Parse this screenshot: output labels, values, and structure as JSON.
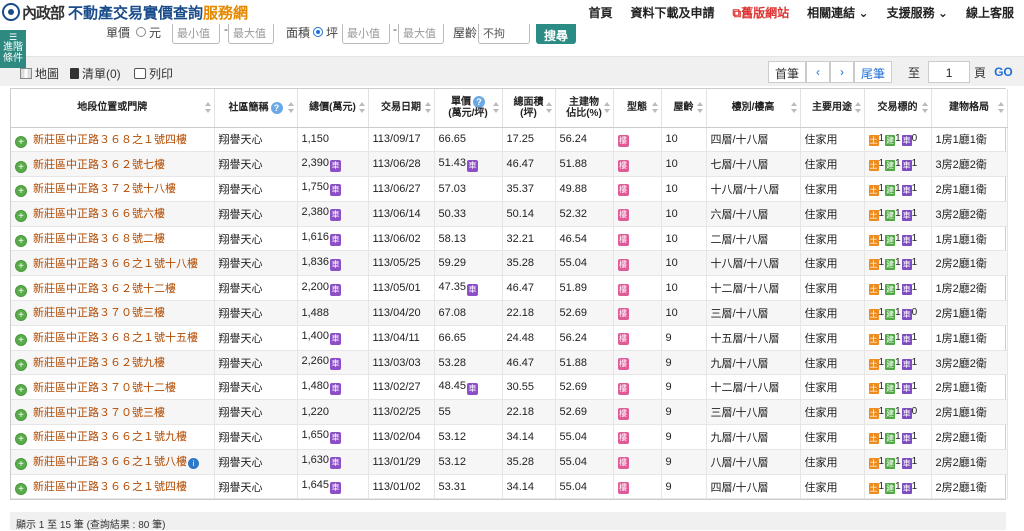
{
  "header": {
    "moi": "內政部",
    "title_main": "不動產交易實價查詢",
    "title_accent": "服務網",
    "nav": [
      "首頁",
      "資料下載及申請",
      "舊版網站",
      "相關連結",
      "支援服務",
      "線上客服"
    ]
  },
  "filter": {
    "unit_price_label": "單價",
    "unit_price_opt": "元",
    "min_placeholder": "最小值",
    "max_placeholder": "最大值",
    "area_label": "面積",
    "area_opt": "坪",
    "age_label": "屋齡",
    "age_value": "不拘",
    "search_label": "搜尋"
  },
  "advanced_filter": "進階條件",
  "toolbar": {
    "map": "地圖",
    "list": "清單(0)",
    "print": "列印",
    "first": "首筆",
    "last": "尾筆",
    "goto": "至",
    "page_value": "1",
    "page_unit": "頁",
    "go": "GO"
  },
  "columns": [
    "地段位置或門牌",
    "社區簡稱",
    "總價(萬元)",
    "交易日期",
    "單價",
    "(萬元/坪)",
    "總面積",
    "(坪)",
    "主建物",
    "佔比(%)",
    "型態",
    "屋齡",
    "樓別/樓高",
    "主要用途",
    "交易標的",
    "建物格局"
  ],
  "badges": {
    "parking": "車",
    "type": "樓",
    "land": "土",
    "building": "建",
    "car": "車"
  },
  "rows": [
    {
      "addr": "新莊區中正路３６８之１號四樓",
      "community": "翔譽天心",
      "total": "1,150",
      "park": false,
      "date": "113/09/17",
      "unit": "66.65",
      "upark": false,
      "area": "17.25",
      "main": "56.24",
      "age": "10",
      "floor": "四層/十八層",
      "use": "住家用",
      "land": "1",
      "bld": "1",
      "car": "0",
      "layout": "1房1廳1衛",
      "info": false
    },
    {
      "addr": "新莊區中正路３６２號七樓",
      "community": "翔譽天心",
      "total": "2,390",
      "park": true,
      "date": "113/06/28",
      "unit": "51.43",
      "upark": true,
      "area": "46.47",
      "main": "51.88",
      "age": "10",
      "floor": "七層/十八層",
      "use": "住家用",
      "land": "1",
      "bld": "1",
      "car": "1",
      "layout": "3房2廳2衛",
      "info": false
    },
    {
      "addr": "新莊區中正路３７２號十八樓",
      "community": "翔譽天心",
      "total": "1,750",
      "park": true,
      "date": "113/06/27",
      "unit": "57.03",
      "upark": false,
      "area": "35.37",
      "main": "49.88",
      "age": "10",
      "floor": "十八層/十八層",
      "use": "住家用",
      "land": "1",
      "bld": "1",
      "car": "1",
      "layout": "2房1廳1衛",
      "info": false
    },
    {
      "addr": "新莊區中正路３６６號六樓",
      "community": "翔譽天心",
      "total": "2,380",
      "park": true,
      "date": "113/06/14",
      "unit": "50.33",
      "upark": false,
      "area": "50.14",
      "main": "52.32",
      "age": "10",
      "floor": "六層/十八層",
      "use": "住家用",
      "land": "1",
      "bld": "1",
      "car": "1",
      "layout": "3房2廳2衛",
      "info": false
    },
    {
      "addr": "新莊區中正路３６８號二樓",
      "community": "翔譽天心",
      "total": "1,616",
      "park": true,
      "date": "113/06/02",
      "unit": "58.13",
      "upark": false,
      "area": "32.21",
      "main": "46.54",
      "age": "10",
      "floor": "二層/十八層",
      "use": "住家用",
      "land": "1",
      "bld": "1",
      "car": "1",
      "layout": "1房1廳1衛",
      "info": false
    },
    {
      "addr": "新莊區中正路３６６之１號十八樓",
      "community": "翔譽天心",
      "total": "1,836",
      "park": true,
      "date": "113/05/25",
      "unit": "59.29",
      "upark": false,
      "area": "35.28",
      "main": "55.04",
      "age": "10",
      "floor": "十八層/十八層",
      "use": "住家用",
      "land": "1",
      "bld": "1",
      "car": "1",
      "layout": "2房2廳1衛",
      "info": false
    },
    {
      "addr": "新莊區中正路３６２號十二樓",
      "community": "翔譽天心",
      "total": "2,200",
      "park": true,
      "date": "113/05/01",
      "unit": "47.35",
      "upark": true,
      "area": "46.47",
      "main": "51.89",
      "age": "10",
      "floor": "十二層/十八層",
      "use": "住家用",
      "land": "1",
      "bld": "1",
      "car": "1",
      "layout": "1房2廳2衛",
      "info": false
    },
    {
      "addr": "新莊區中正路３７０號三樓",
      "community": "翔譽天心",
      "total": "1,488",
      "park": false,
      "date": "113/04/20",
      "unit": "67.08",
      "upark": false,
      "area": "22.18",
      "main": "52.69",
      "age": "10",
      "floor": "三層/十八層",
      "use": "住家用",
      "land": "1",
      "bld": "1",
      "car": "0",
      "layout": "2房1廳1衛",
      "info": false
    },
    {
      "addr": "新莊區中正路３６８之１號十五樓",
      "community": "翔譽天心",
      "total": "1,400",
      "park": true,
      "date": "113/04/11",
      "unit": "66.65",
      "upark": false,
      "area": "24.48",
      "main": "56.24",
      "age": "9",
      "floor": "十五層/十八層",
      "use": "住家用",
      "land": "1",
      "bld": "1",
      "car": "1",
      "layout": "1房1廳1衛",
      "info": false
    },
    {
      "addr": "新莊區中正路３６２號九樓",
      "community": "翔譽天心",
      "total": "2,260",
      "park": true,
      "date": "113/03/03",
      "unit": "53.28",
      "upark": false,
      "area": "46.47",
      "main": "51.88",
      "age": "9",
      "floor": "九層/十八層",
      "use": "住家用",
      "land": "1",
      "bld": "1",
      "car": "1",
      "layout": "3房2廳2衛",
      "info": false
    },
    {
      "addr": "新莊區中正路３７０號十二樓",
      "community": "翔譽天心",
      "total": "1,480",
      "park": true,
      "date": "113/02/27",
      "unit": "48.45",
      "upark": true,
      "area": "30.55",
      "main": "52.69",
      "age": "9",
      "floor": "十二層/十八層",
      "use": "住家用",
      "land": "1",
      "bld": "1",
      "car": "1",
      "layout": "2房1廳1衛",
      "info": false
    },
    {
      "addr": "新莊區中正路３７０號三樓",
      "community": "翔譽天心",
      "total": "1,220",
      "park": false,
      "date": "113/02/25",
      "unit": "55",
      "upark": false,
      "area": "22.18",
      "main": "52.69",
      "age": "9",
      "floor": "三層/十八層",
      "use": "住家用",
      "land": "1",
      "bld": "1",
      "car": "0",
      "layout": "2房1廳1衛",
      "info": false
    },
    {
      "addr": "新莊區中正路３６６之１號九樓",
      "community": "翔譽天心",
      "total": "1,650",
      "park": true,
      "date": "113/02/04",
      "unit": "53.12",
      "upark": false,
      "area": "34.14",
      "main": "55.04",
      "age": "9",
      "floor": "九層/十八層",
      "use": "住家用",
      "land": "1",
      "bld": "1",
      "car": "1",
      "layout": "2房2廳1衛",
      "info": false
    },
    {
      "addr": "新莊區中正路３６６之１號八樓",
      "community": "翔譽天心",
      "total": "1,630",
      "park": true,
      "date": "113/01/29",
      "unit": "53.12",
      "upark": false,
      "area": "35.28",
      "main": "55.04",
      "age": "9",
      "floor": "八層/十八層",
      "use": "住家用",
      "land": "1",
      "bld": "1",
      "car": "1",
      "layout": "2房2廳1衛",
      "info": true
    },
    {
      "addr": "新莊區中正路３６６之１號四樓",
      "community": "翔譽天心",
      "total": "1,645",
      "park": true,
      "date": "113/01/02",
      "unit": "53.31",
      "upark": false,
      "area": "34.14",
      "main": "55.04",
      "age": "9",
      "floor": "四層/十八層",
      "use": "住家用",
      "land": "1",
      "bld": "1",
      "car": "1",
      "layout": "2房2廳1衛",
      "info": false
    }
  ],
  "footer": "顯示 1 至 15 筆 (查詢結果 : 80 筆)"
}
